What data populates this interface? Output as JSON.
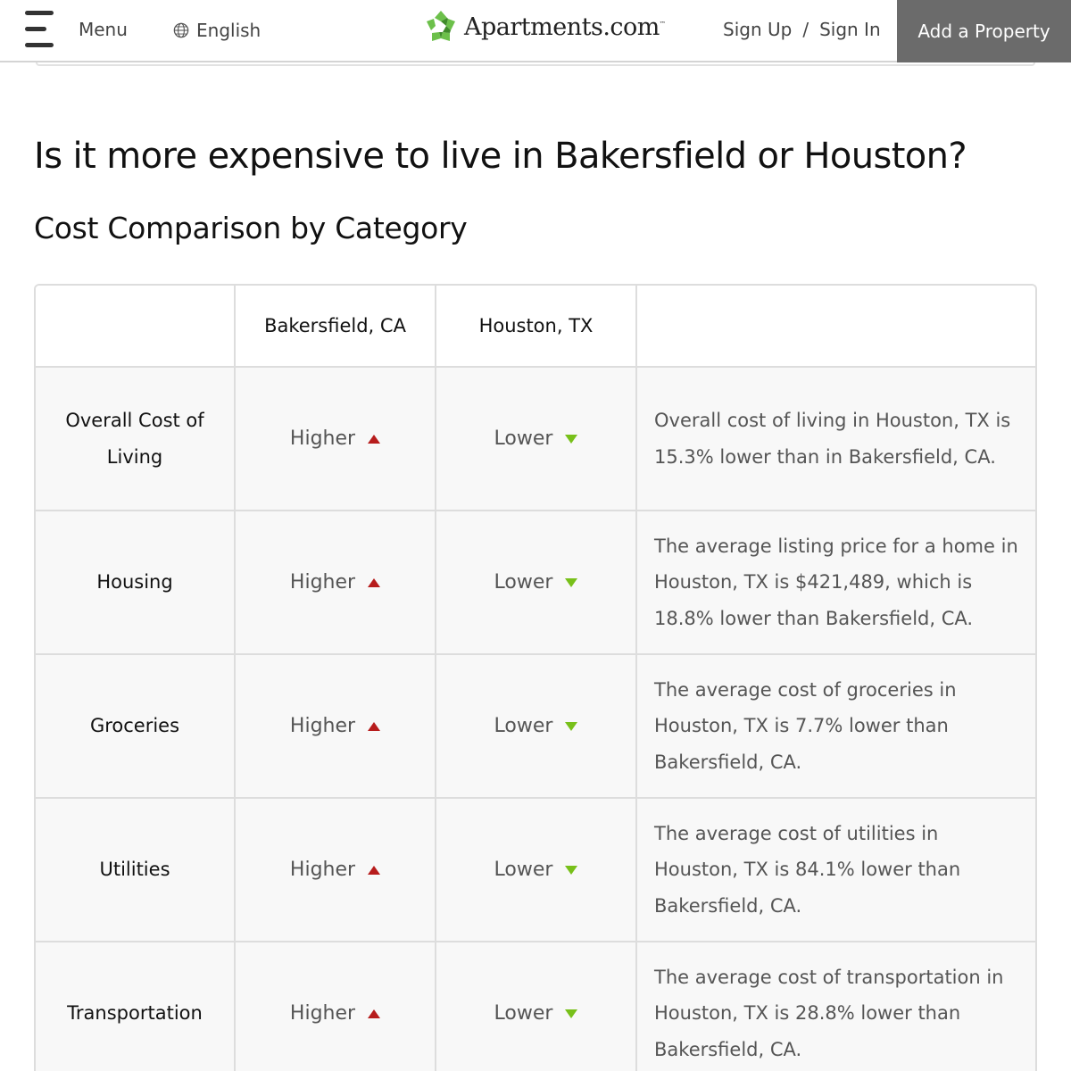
{
  "header": {
    "menu_label": "Menu",
    "language": "English",
    "logo_text": "Apartments.com",
    "logo_tm": "™",
    "sign_up": "Sign Up",
    "separator": "/",
    "sign_in": "Sign In",
    "add_property": "Add a Property"
  },
  "main": {
    "title": "Is it more expensive to live in Bakersfield or Houston?",
    "subtitle": "Cost Comparison by Category"
  },
  "table": {
    "columns": [
      "",
      "Bakersfield, CA",
      "Houston, TX",
      ""
    ],
    "rows": [
      {
        "category": "Overall Cost of Living",
        "city1": "Higher",
        "city2": "Lower",
        "description": "Overall cost of living in Houston, TX is 15.3% lower than in Bakersfield, CA."
      },
      {
        "category": "Housing",
        "city1": "Higher",
        "city2": "Lower",
        "description": "The average listing price for a home in Houston, TX is $421,489, which is 18.8% lower than Bakersfield, CA."
      },
      {
        "category": "Groceries",
        "city1": "Higher",
        "city2": "Lower",
        "description": "The average cost of groceries in Houston, TX is 7.7% lower than Bakersfield, CA."
      },
      {
        "category": "Utilities",
        "city1": "Higher",
        "city2": "Lower",
        "description": "The average cost of utilities in Houston, TX is 84.1% lower than Bakersfield, CA."
      },
      {
        "category": "Transportation",
        "city1": "Higher",
        "city2": "Lower",
        "description": "The average cost of transportation in Houston, TX is 28.8% lower than Bakersfield, CA."
      }
    ]
  },
  "icons": {
    "higher": "triangle-up-icon",
    "lower": "triangle-down-icon",
    "language": "globe-icon",
    "menu": "hamburger-icon"
  },
  "colors": {
    "higher": "#b71c1c",
    "lower": "#78c01a",
    "logo_green": "#6cc04a",
    "add_property_bg": "#6b6b6b"
  }
}
